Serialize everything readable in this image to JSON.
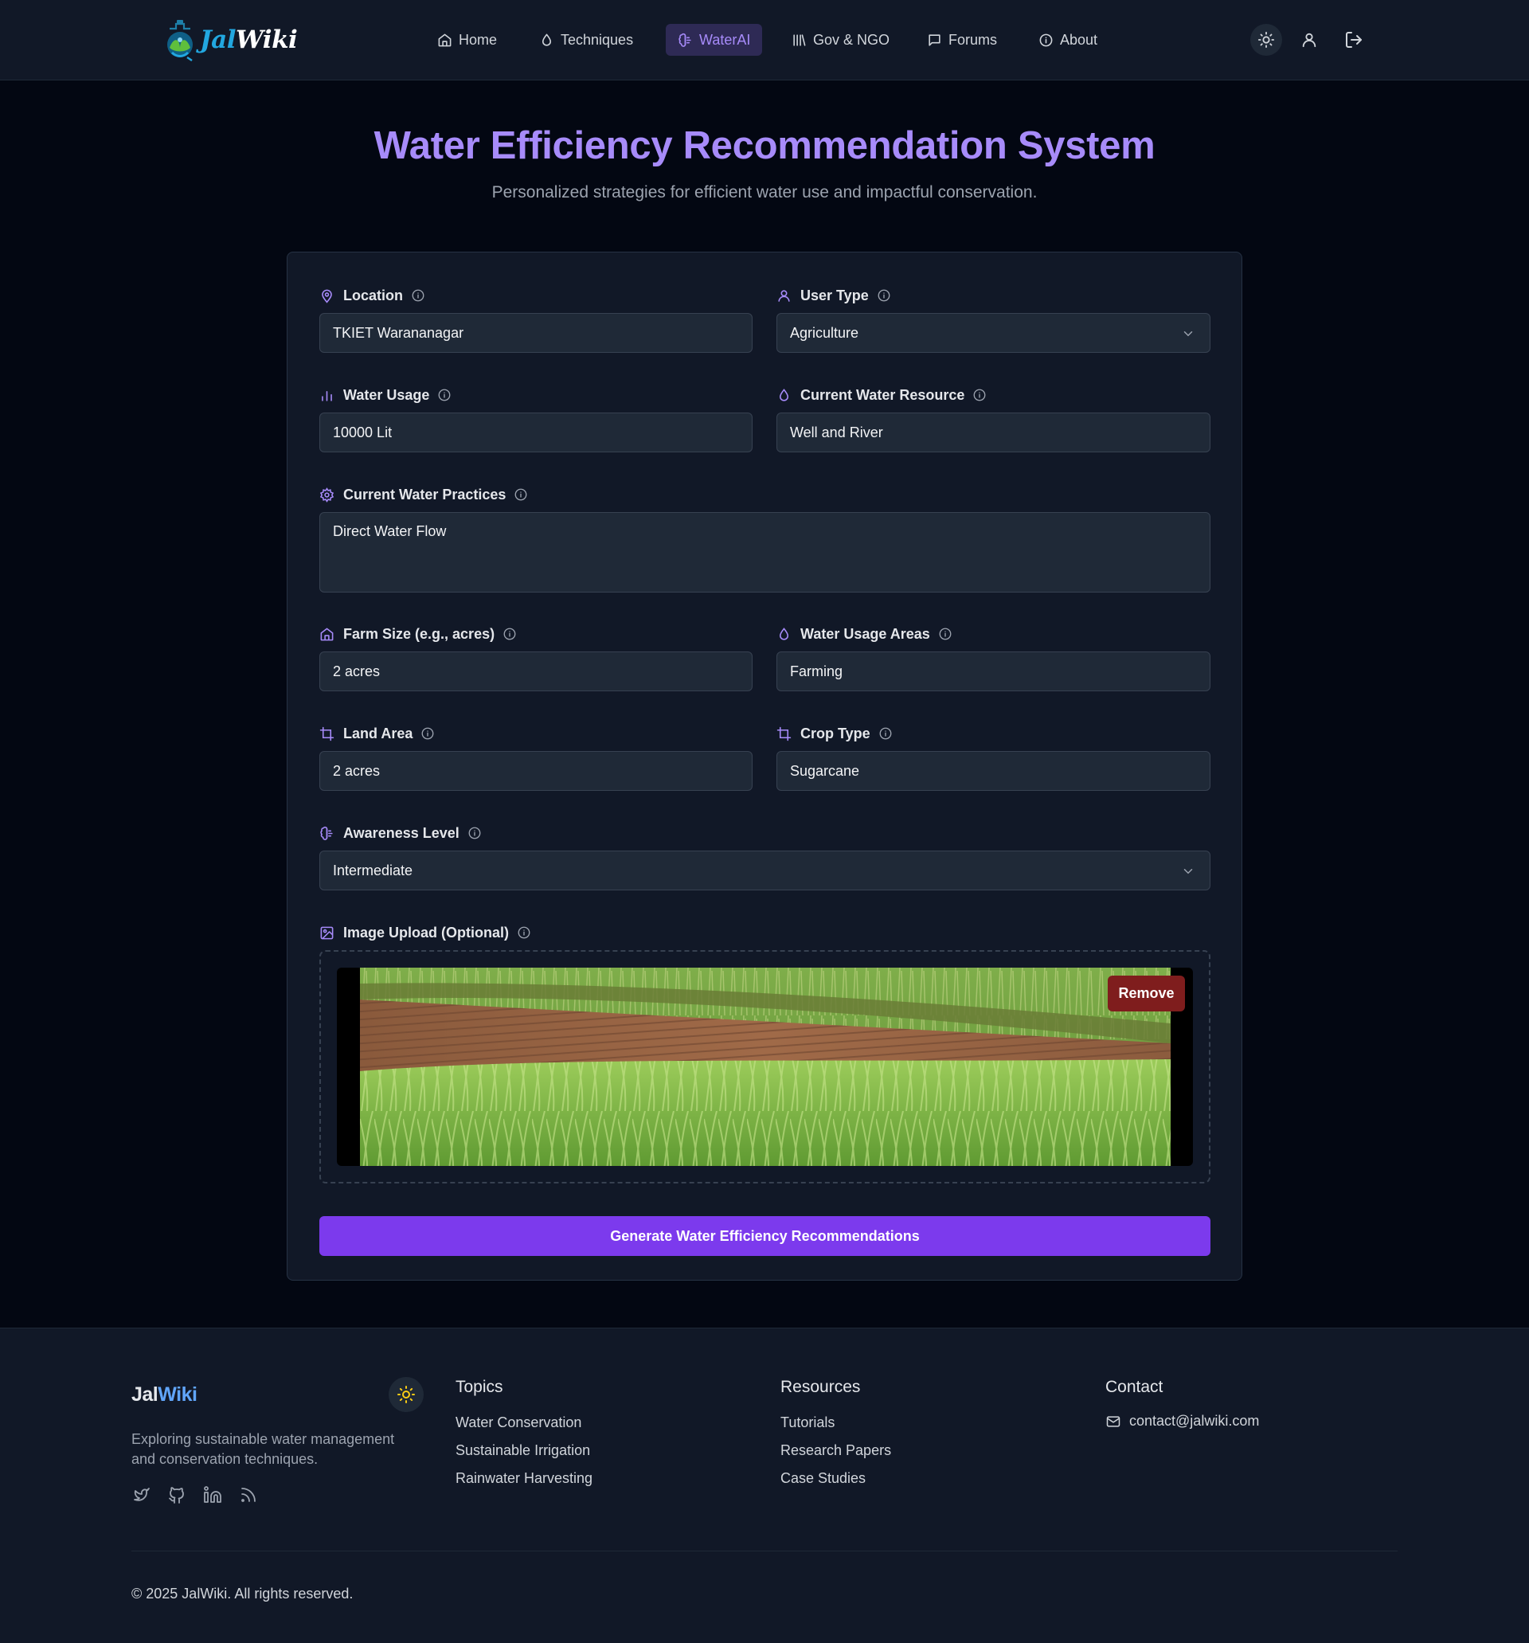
{
  "brand": {
    "logo_part1": "Jal",
    "logo_part2": "Wiki"
  },
  "nav": {
    "items": [
      {
        "label": "Home",
        "icon": "home-icon"
      },
      {
        "label": "Techniques",
        "icon": "droplet-icon"
      },
      {
        "label": "WaterAI",
        "icon": "brain-icon",
        "active": true
      },
      {
        "label": "Gov & NGO",
        "icon": "library-icon"
      },
      {
        "label": "Forums",
        "icon": "chat-icon"
      },
      {
        "label": "About",
        "icon": "info-icon"
      }
    ],
    "actions": [
      "sun-icon",
      "user-icon",
      "logout-icon"
    ]
  },
  "header": {
    "title": "Water Efficiency Recommendation System",
    "subtitle": "Personalized strategies for efficient water use and impactful conservation."
  },
  "form": {
    "location": {
      "label": "Location",
      "value": "TKIET Warananagar",
      "icon": "map-pin-icon"
    },
    "user_type": {
      "label": "User Type",
      "value": "Agriculture",
      "icon": "user-icon"
    },
    "water_usage": {
      "label": "Water Usage",
      "value": "10000 Lit",
      "icon": "bar-chart-icon"
    },
    "water_resource": {
      "label": "Current Water Resource",
      "value": "Well and River",
      "icon": "droplet-icon"
    },
    "water_practices": {
      "label": "Current Water Practices",
      "value": "Direct Water Flow",
      "icon": "gear-icon"
    },
    "farm_size": {
      "label": "Farm Size (e.g., acres)",
      "value": "2 acres",
      "icon": "home-icon"
    },
    "usage_areas": {
      "label": "Water Usage Areas",
      "value": "Farming",
      "icon": "droplet-icon"
    },
    "land_area": {
      "label": "Land Area",
      "value": "2 acres",
      "icon": "crop-icon"
    },
    "crop_type": {
      "label": "Crop Type",
      "value": "Sugarcane",
      "icon": "crop-icon"
    },
    "awareness": {
      "label": "Awareness Level",
      "value": "Intermediate",
      "icon": "brain-icon"
    },
    "image_upload": {
      "label": "Image Upload (Optional)",
      "remove_label": "Remove",
      "icon": "image-icon"
    },
    "submit_label": "Generate Water Efficiency Recommendations"
  },
  "footer": {
    "brand_part1": "Jal",
    "brand_part2": "Wiki",
    "description": "Exploring sustainable water management and conservation techniques.",
    "socials": [
      "twitter-icon",
      "github-icon",
      "linkedin-icon",
      "rss-icon"
    ],
    "topics": {
      "heading": "Topics",
      "links": [
        "Water Conservation",
        "Sustainable Irrigation",
        "Rainwater Harvesting"
      ]
    },
    "resources": {
      "heading": "Resources",
      "links": [
        "Tutorials",
        "Research Papers",
        "Case Studies"
      ]
    },
    "contact": {
      "heading": "Contact",
      "email": "contact@jalwiki.com"
    },
    "copyright": "© 2025 JalWiki. All rights reserved."
  },
  "colors": {
    "background": "#030712",
    "surface": "#111827",
    "field": "#1f2937",
    "accent": "#a78bfa",
    "button": "#7c3aed",
    "danger": "#7f1d1d",
    "link_blue": "#60a5fa"
  }
}
